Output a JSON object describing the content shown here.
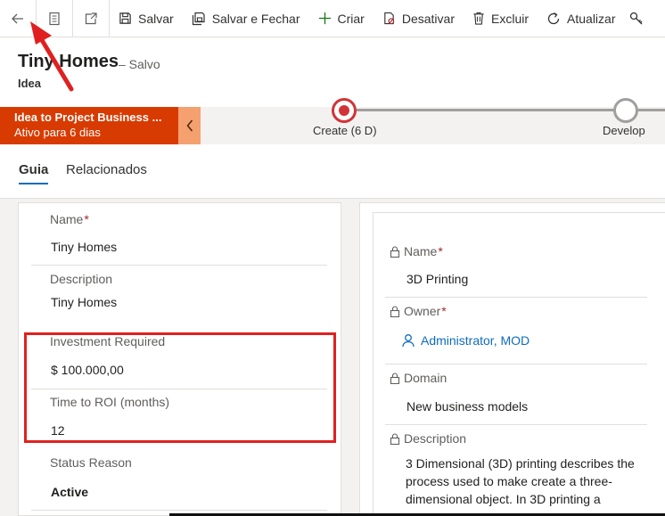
{
  "toolbar": {
    "save": "Salvar",
    "save_close": "Salvar e Fechar",
    "new": "Criar",
    "deactivate": "Desativar",
    "delete": "Excluir",
    "refresh": "Atualizar"
  },
  "header": {
    "title": "Tiny Homes",
    "saved_status": "– Salvo",
    "entity": "Idea"
  },
  "bpf": {
    "process_name": "Idea to Project Business ...",
    "active_for": "Ativo para 6 dias",
    "stages": [
      {
        "label": "Create  (6 D)",
        "state": "active"
      },
      {
        "label": "Develop",
        "state": "pending"
      }
    ]
  },
  "tabs": [
    {
      "label": "Guia",
      "selected": true
    },
    {
      "label": "Relacionados",
      "selected": false
    }
  ],
  "left_section": {
    "fields": [
      {
        "label": "Name",
        "required": true,
        "value": "Tiny Homes"
      },
      {
        "label": "Description",
        "required": false,
        "value": "Tiny Homes"
      },
      {
        "label": "Investment Required",
        "required": false,
        "value": "$ 100.000,00"
      },
      {
        "label": "Time to ROI (months)",
        "required": false,
        "value": "12"
      },
      {
        "label": "Status Reason",
        "required": false,
        "value": "Active"
      }
    ]
  },
  "right_section": {
    "fields": [
      {
        "label": "Name",
        "required": true,
        "locked": true,
        "value": "3D Printing"
      },
      {
        "label": "Owner",
        "required": true,
        "locked": true,
        "value": "Administrator, MOD"
      },
      {
        "label": "Domain",
        "required": false,
        "locked": true,
        "value": "New business models"
      },
      {
        "label": "Description",
        "required": false,
        "locked": true,
        "value": "3 Dimensional (3D) printing describes the process used to make create a three-dimensional object. In 3D printing a"
      }
    ]
  },
  "req_mark": "*",
  "colors": {
    "bpf_active": "#d83b01",
    "accent": "#0f6cbd",
    "annotation": "#e02020"
  }
}
